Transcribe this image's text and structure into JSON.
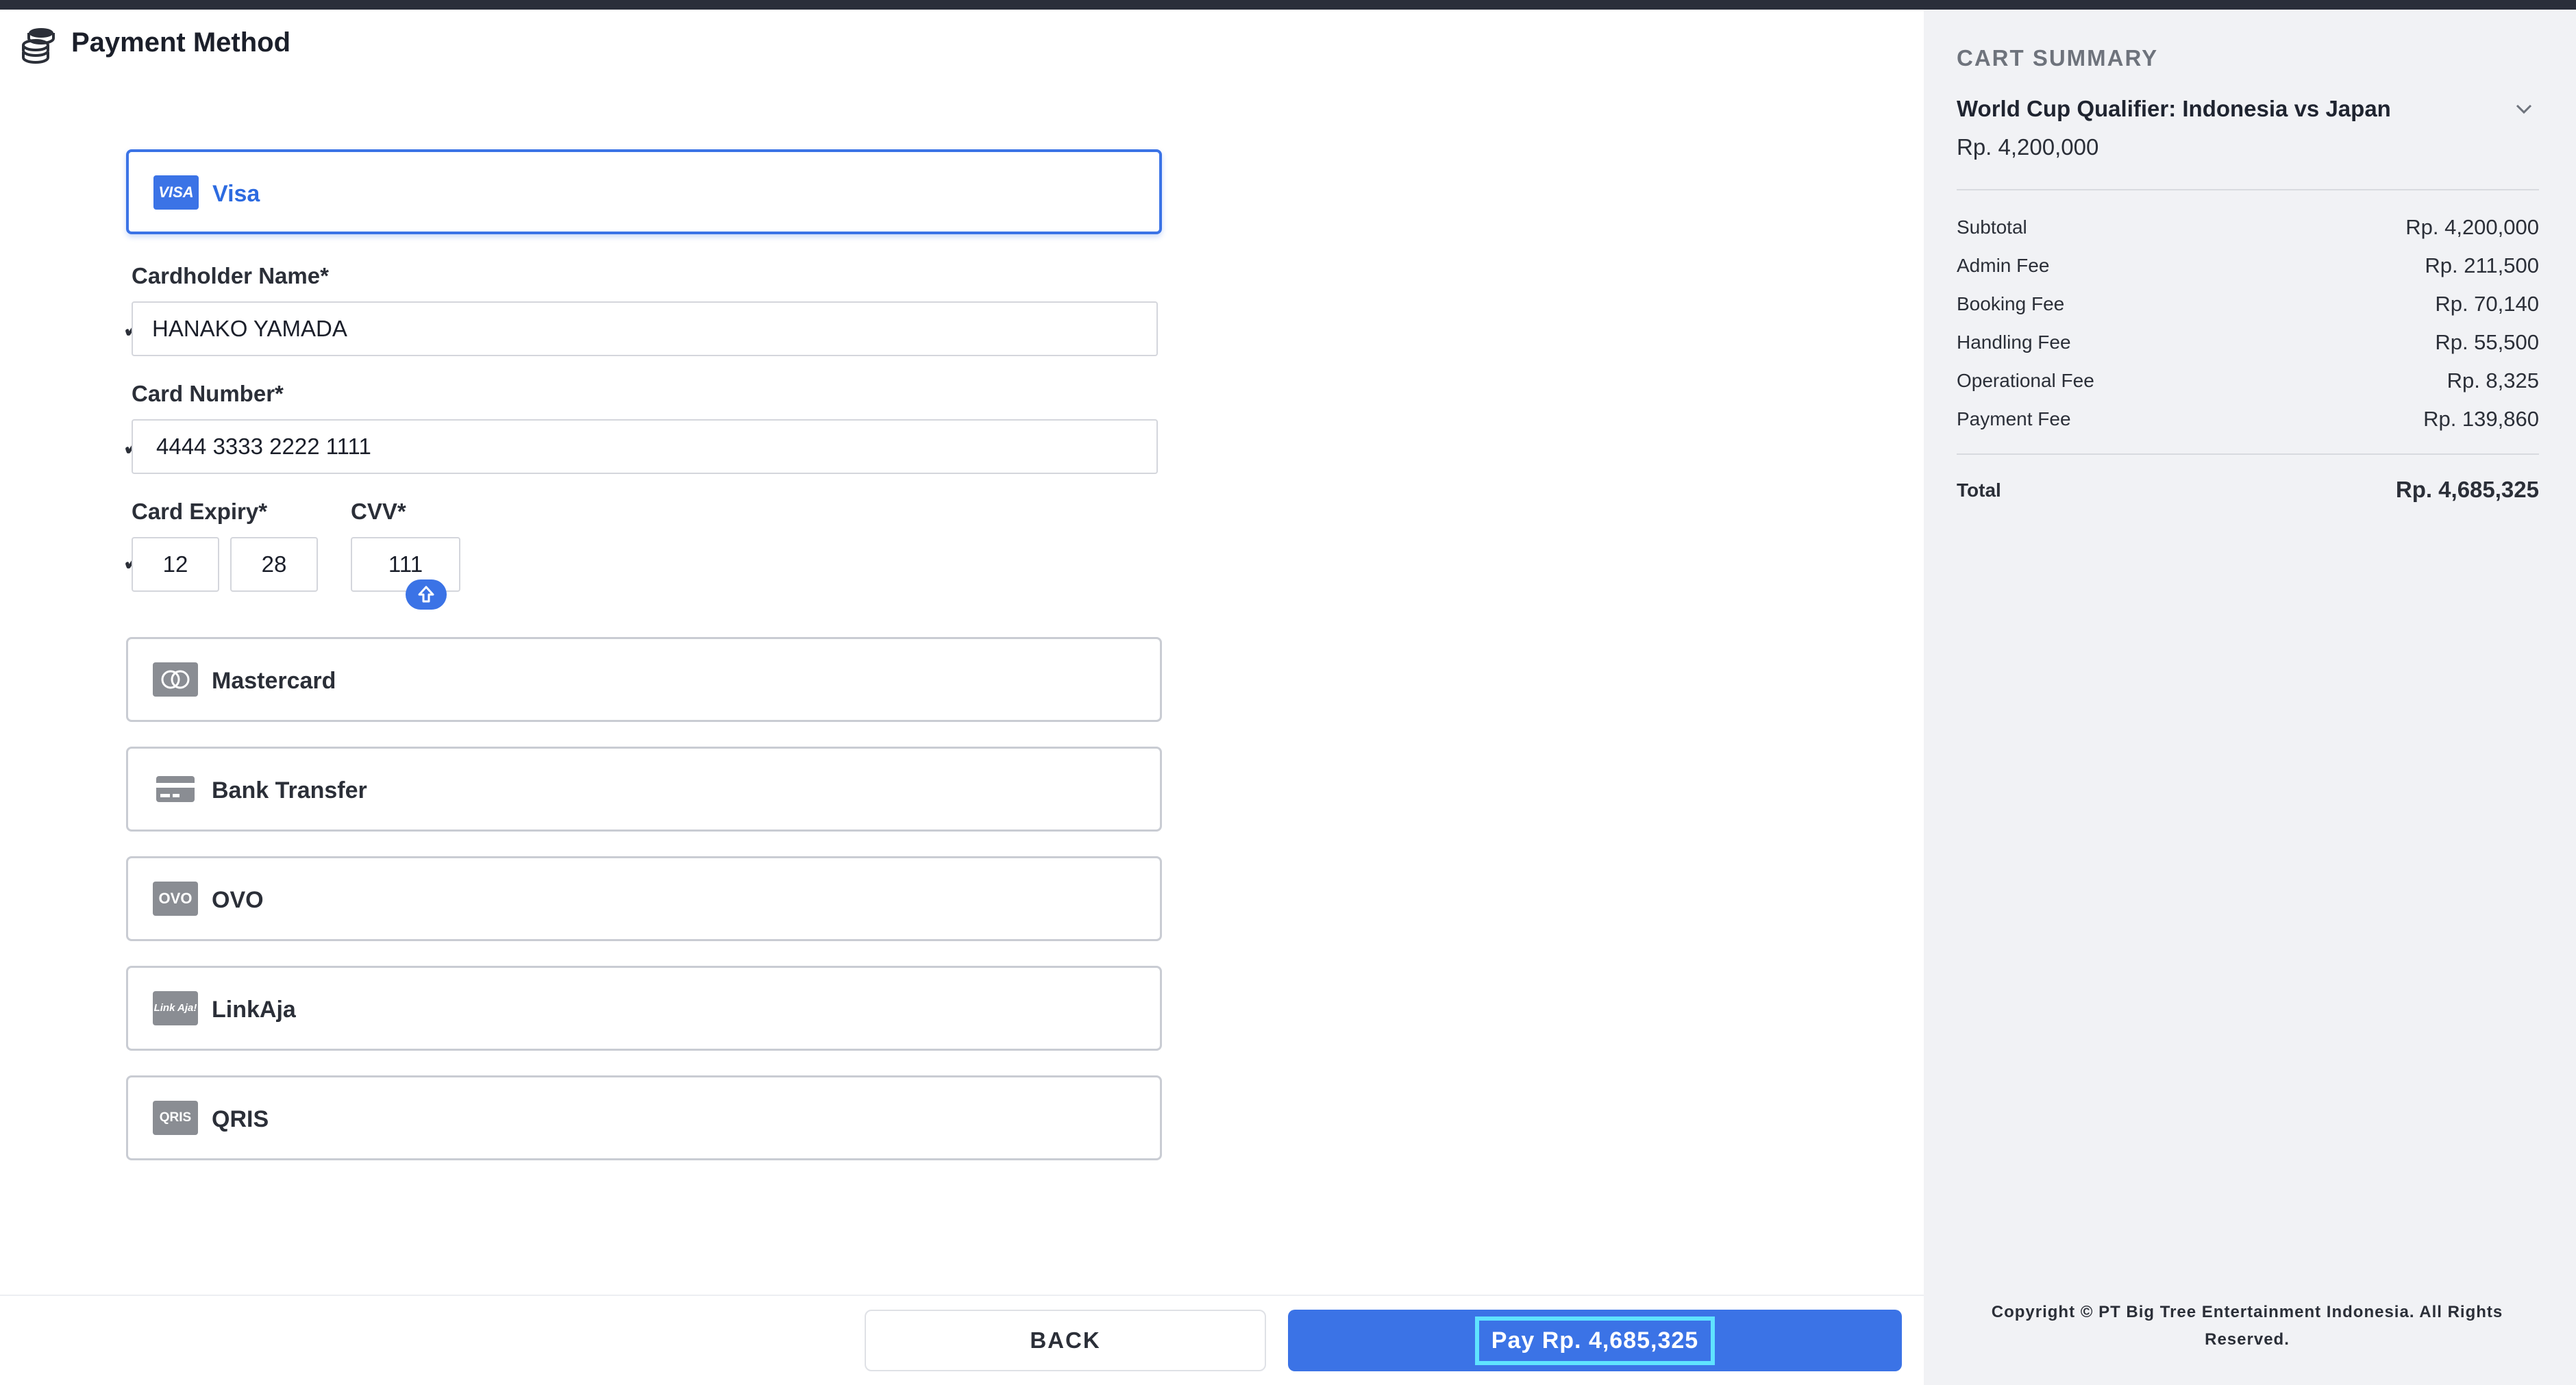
{
  "header": {
    "title": "Payment Method",
    "icon": "coins-icon"
  },
  "payment_options": {
    "visa": {
      "label": "Visa",
      "icon_text": "VISA"
    },
    "mastercard": {
      "label": "Mastercard"
    },
    "bank_transfer": {
      "label": "Bank Transfer"
    },
    "ovo": {
      "label": "OVO",
      "icon_text": "OVO"
    },
    "linkaja": {
      "label": "LinkAja",
      "icon_text": "Link Aja!"
    },
    "qris": {
      "label": "QRIS",
      "icon_text": "QRIS"
    }
  },
  "form": {
    "cardholder_label": "Cardholder Name*",
    "cardholder_value": "HANAKO YAMADA",
    "card_number_label": "Card Number*",
    "card_number_value": "4444 3333 2222 1111",
    "expiry_label": "Card Expiry*",
    "expiry_month": "12",
    "expiry_year": "28",
    "cvv_label": "CVV*",
    "cvv_value": "111",
    "check_mark": "✓"
  },
  "buttons": {
    "back": "BACK",
    "pay": "Pay Rp. 4,685,325"
  },
  "cart": {
    "title": "CART SUMMARY",
    "event": "World Cup Qualifier: Indonesia vs Japan",
    "event_price": "Rp. 4,200,000",
    "fees": [
      {
        "label": "Subtotal",
        "value": "Rp. 4,200,000"
      },
      {
        "label": "Admin Fee",
        "value": "Rp. 211,500"
      },
      {
        "label": "Booking Fee",
        "value": "Rp. 70,140"
      },
      {
        "label": "Handling Fee",
        "value": "Rp. 55,500"
      },
      {
        "label": "Operational Fee",
        "value": "Rp. 8,325"
      },
      {
        "label": "Payment Fee",
        "value": "Rp. 139,860"
      }
    ],
    "total_label": "Total",
    "total_value": "Rp. 4,685,325",
    "copyright": "Copyright © PT Big Tree Entertainment Indonesia. All Rights Reserved."
  },
  "colors": {
    "accent": "#3b73e6",
    "focus_outline": "#5fe3ff",
    "sidebar_bg": "#f1f2f5",
    "topbar": "#2a2e3a"
  }
}
